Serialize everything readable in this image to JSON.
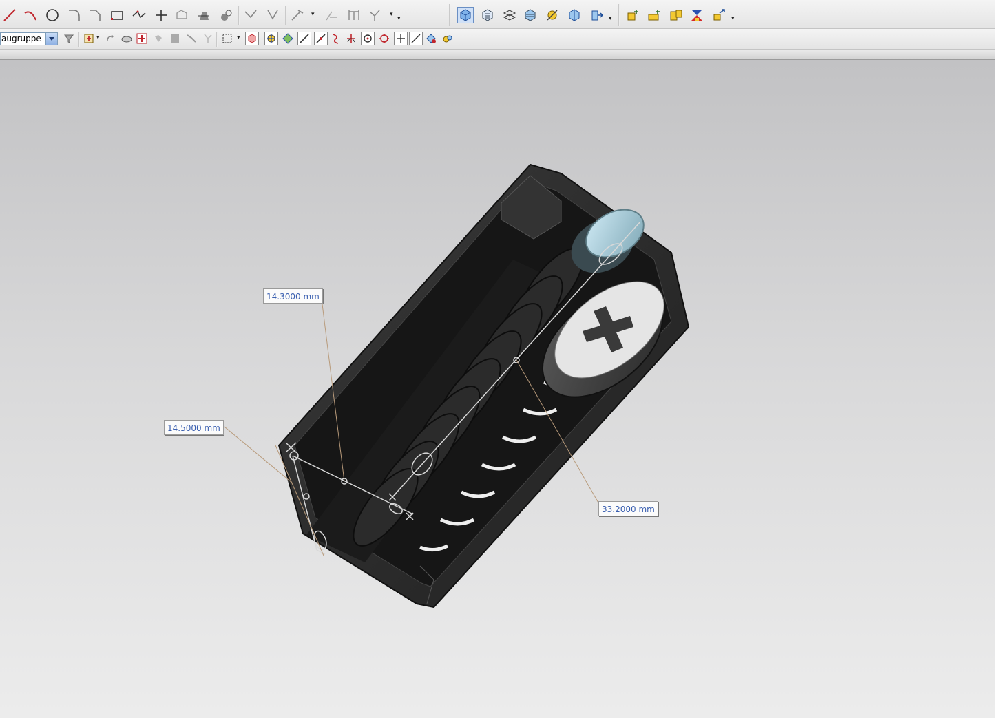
{
  "toolbar_row2": {
    "group_select_value": "augruppe"
  },
  "dimensions": [
    {
      "id": "dim-1",
      "value": "14.3000 mm"
    },
    {
      "id": "dim-2",
      "value": "14.5000 mm"
    },
    {
      "id": "dim-3",
      "value": "33.2000 mm"
    }
  ],
  "icons": {
    "row1": [
      "line-icon",
      "arc-icon",
      "circle-icon",
      "fillet-icon",
      "chamfer-icon",
      "rectangle-icon",
      "polyline-icon",
      "point-icon",
      "offset-curve-icon",
      "trim-icon",
      "extend-icon",
      "trim-corner-icon",
      "split-curve-icon",
      "mirror-curve-icon",
      "constraints-icon",
      "dimension-icon",
      "shaded-view-icon",
      "orient-view-icon",
      "section-view-icon",
      "layer-view-icon",
      "render-icon",
      "snap-view-icon",
      "move-object-icon",
      "add-component-icon",
      "new-component-icon",
      "assembly-constraint-icon",
      "reposition-component-icon",
      "explode-view-icon"
    ],
    "row2": [
      "filter-icon",
      "selection-filter-icon",
      "undo-selection-icon",
      "select-face-icon",
      "select-feature-icon",
      "select-body-icon",
      "select-edge-icon",
      "select-tangent-icon",
      "window-select-icon",
      "select-all-icon",
      "snap-point-icon",
      "endpoint-snap-icon",
      "midpoint-snap-icon",
      "control-point-icon",
      "intersection-snap-icon",
      "center-snap-icon",
      "quadrant-snap-icon",
      "point-on-curve-icon",
      "point-on-surface-icon",
      "bounded-snap-icon",
      "snap-settings-icon"
    ]
  },
  "colors": {
    "dimension_text": "#3a5fb0",
    "model_body": "#2b2b2b",
    "background_top": "#c2c2c4",
    "background_bottom": "#ececec"
  }
}
